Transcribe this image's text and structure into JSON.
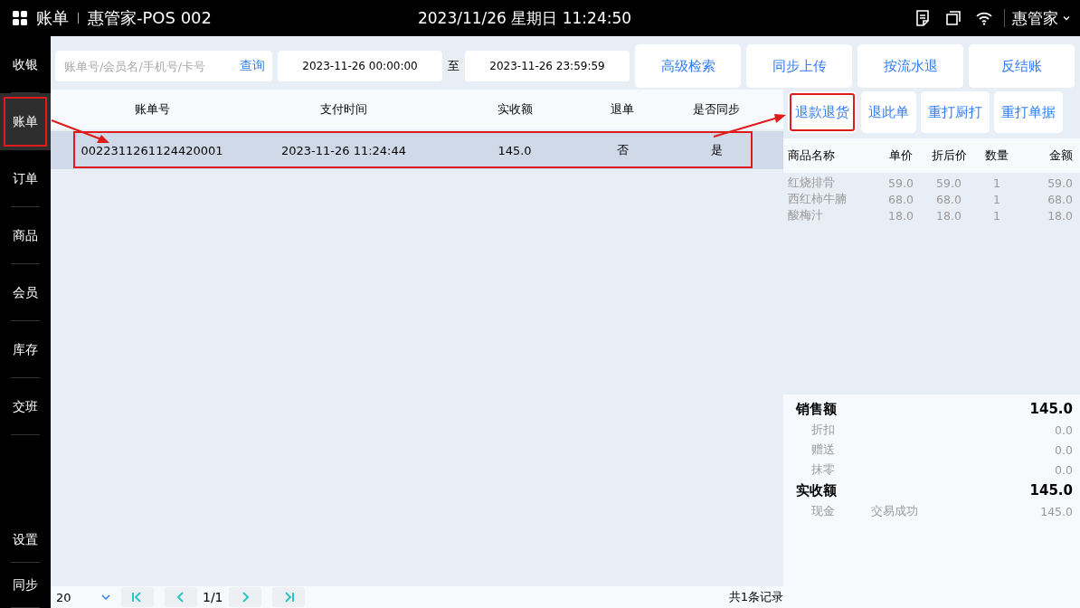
{
  "status_bar": {
    "page_title": "账单",
    "store": "惠管家-POS 002",
    "datetime": "2023/11/26 星期日 11:24:50",
    "user": "惠管家"
  },
  "sidebar": {
    "items": [
      {
        "label": "收银",
        "selected": false,
        "highlighted": false
      },
      {
        "label": "账单",
        "selected": true,
        "highlighted": true
      },
      {
        "label": "订单",
        "selected": false,
        "highlighted": false
      },
      {
        "label": "商品",
        "selected": false,
        "highlighted": false
      },
      {
        "label": "会员",
        "selected": false,
        "highlighted": false
      },
      {
        "label": "库存",
        "selected": false,
        "highlighted": false
      },
      {
        "label": "交班",
        "selected": false,
        "highlighted": false
      }
    ],
    "bottom_items": [
      {
        "label": "设置",
        "selected": false
      },
      {
        "label": "同步",
        "selected": false
      }
    ]
  },
  "filters": {
    "search_placeholder": "账单号/会员名/手机号/卡号",
    "search_button": "查询",
    "start": "2023-11-26 00:00:00",
    "separator": "至",
    "end": "2023-11-26 23:59:59",
    "buttons": [
      "高级检索",
      "同步上传",
      "按流水退",
      "反结账"
    ]
  },
  "bills": {
    "columns": [
      "账单号",
      "支付时间",
      "实收额",
      "退单",
      "是否同步"
    ],
    "rows": [
      {
        "cells": [
          "0022311261124420001",
          "2023-11-26 11:24:44",
          "145.0",
          "否",
          "是"
        ],
        "selected": true,
        "highlighted": true
      }
    ]
  },
  "pagination": {
    "page_size": "20",
    "page": "1/1",
    "total": "共1条记录"
  },
  "detail": {
    "actions": [
      {
        "label": "退款退货",
        "highlighted": true
      },
      {
        "label": "退此单",
        "highlighted": false
      },
      {
        "label": "重打厨打",
        "highlighted": false
      },
      {
        "label": "重打单据",
        "highlighted": false
      }
    ],
    "columns": [
      "商品名称",
      "单价",
      "折后价",
      "数量",
      "金额"
    ],
    "items": [
      [
        "红烧排骨",
        "59.0",
        "59.0",
        "1",
        "59.0"
      ],
      [
        "西红柿牛腩",
        "68.0",
        "68.0",
        "1",
        "68.0"
      ],
      [
        "酸梅汁",
        "18.0",
        "18.0",
        "1",
        "18.0"
      ]
    ]
  },
  "summary": {
    "rows": [
      {
        "kind": "total",
        "label": "销售额",
        "value": "145.0"
      },
      {
        "kind": "sub",
        "label": "折扣",
        "value": "0.0"
      },
      {
        "kind": "sub",
        "label": "赠送",
        "value": "0.0"
      },
      {
        "kind": "sub",
        "label": "抹零",
        "value": "0.0"
      },
      {
        "kind": "total",
        "label": "实收额",
        "value": "145.0"
      },
      {
        "kind": "payment",
        "label": "现金",
        "status": "交易成功",
        "value": "145.0"
      }
    ]
  }
}
